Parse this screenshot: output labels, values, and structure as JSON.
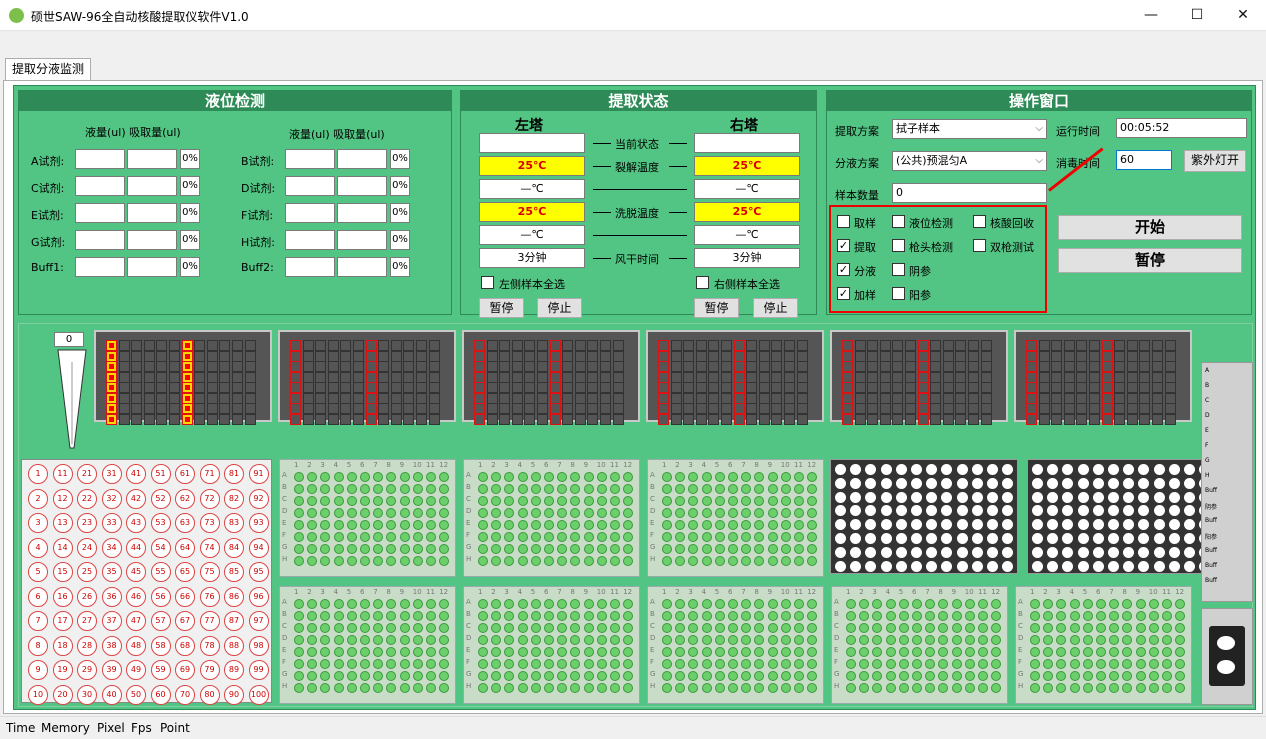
{
  "window": {
    "title": "硕世SAW-96全自动核酸提取仪软件V1.0",
    "min": "—",
    "max": "☐",
    "close": "✕"
  },
  "tab": {
    "label": "提取分液监测"
  },
  "liquid": {
    "title": "液位检测",
    "colhead": "液量(ul) 吸取量(ul)",
    "left": [
      {
        "label": "A试剂:",
        "pct": "0%"
      },
      {
        "label": "C试剂:",
        "pct": "0%"
      },
      {
        "label": "E试剂:",
        "pct": "0%"
      },
      {
        "label": "G试剂:",
        "pct": "0%"
      },
      {
        "label": "Buff1:",
        "pct": "0%"
      }
    ],
    "right": [
      {
        "label": "B试剂:",
        "pct": "0%"
      },
      {
        "label": "D试剂:",
        "pct": "0%"
      },
      {
        "label": "F试剂:",
        "pct": "0%"
      },
      {
        "label": "H试剂:",
        "pct": "0%"
      },
      {
        "label": "Buff2:",
        "pct": "0%"
      }
    ]
  },
  "extract": {
    "title": "提取状态",
    "left": "左塔",
    "right": "右塔",
    "rows": [
      {
        "label": "当前状态",
        "l": "",
        "r": ""
      },
      {
        "label": "裂解温度",
        "l": "25℃",
        "r": "25℃"
      },
      {
        "label": "",
        "l": "—℃",
        "r": "—℃"
      },
      {
        "label": "洗脱温度",
        "l": "25℃",
        "r": "25℃"
      },
      {
        "label": "",
        "l": "—℃",
        "r": "—℃"
      },
      {
        "label": "风干时间",
        "l": "3分钟",
        "r": "3分钟"
      }
    ],
    "selectLeft": "左侧样本全选",
    "selectRight": "右侧样本全选",
    "pause": "暂停",
    "stop": "停止"
  },
  "ops": {
    "title": "操作窗口",
    "schemeLabel": "提取方案",
    "schemeVal": "拭子样本",
    "splitLabel": "分液方案",
    "splitVal": "(公共)预混匀A",
    "countLabel": "样本数量",
    "countVal": "0",
    "runLabel": "运行时间",
    "runVal": "00:05:52",
    "disLabel": "消毒时间",
    "disVal": "60",
    "uv": "紫外灯开",
    "start": "开始",
    "pause": "暂停",
    "checks": [
      {
        "label": "取样",
        "checked": false
      },
      {
        "label": "液位检测",
        "checked": false
      },
      {
        "label": "核酸回收",
        "checked": false
      },
      {
        "label": "提取",
        "checked": true
      },
      {
        "label": "枪头检测",
        "checked": false
      },
      {
        "label": "双枪测试",
        "checked": false
      },
      {
        "label": "分液",
        "checked": true
      },
      {
        "label": "阴参",
        "checked": false
      },
      {
        "label": "加样",
        "checked": true
      },
      {
        "label": "阳参",
        "checked": false
      }
    ]
  },
  "tipCount": "0",
  "plateRows": [
    "A",
    "B",
    "C",
    "D",
    "E",
    "F",
    "G",
    "H"
  ],
  "plateCols": [
    "1",
    "2",
    "3",
    "4",
    "5",
    "6",
    "7",
    "8",
    "9",
    "10",
    "11",
    "12"
  ],
  "sideLabels": [
    "A",
    "B",
    "C",
    "D",
    "E",
    "F",
    "G",
    "H",
    "Buff",
    "阴参",
    "Buff",
    "阳参",
    "Buff",
    "Buff",
    "Buff"
  ],
  "status": {
    "time": "Time",
    "memory": "Memory",
    "pixel": "Pixel",
    "fps": "Fps",
    "point": "Point"
  },
  "colors": {
    "green": "#52c483",
    "header": "#2e8b57",
    "highlight": "#ff0000",
    "yellow": "#ffff00"
  }
}
